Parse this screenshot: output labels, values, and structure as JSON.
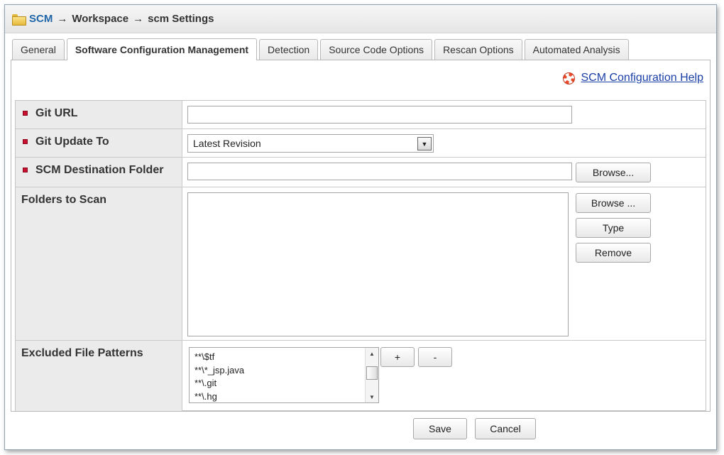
{
  "breadcrumb": {
    "root": "SCM",
    "separator": "→",
    "workspace": "Workspace",
    "current": "scm Settings"
  },
  "tabs": [
    {
      "label": "General",
      "active": false
    },
    {
      "label": "Software Configuration Management",
      "active": true
    },
    {
      "label": "Detection",
      "active": false
    },
    {
      "label": "Source Code Options",
      "active": false
    },
    {
      "label": "Rescan Options",
      "active": false
    },
    {
      "label": "Automated Analysis",
      "active": false
    }
  ],
  "help": {
    "icon": "lifebuoy-icon",
    "label": "SCM Configuration Help"
  },
  "form": {
    "git_url": {
      "label": "Git URL",
      "value": ""
    },
    "git_update_to": {
      "label": "Git Update To",
      "selected": "Latest Revision"
    },
    "scm_destination": {
      "label": "SCM Destination Folder",
      "value": "",
      "browse_label": "Browse..."
    },
    "folders_to_scan": {
      "label": "Folders to Scan",
      "browse_label": "Browse ...",
      "type_label": "Type",
      "remove_label": "Remove"
    },
    "excluded_patterns": {
      "label": "Excluded File Patterns",
      "items": [
        "**\\$tf",
        "**\\*_jsp.java",
        "**\\.git",
        "**\\.hg"
      ],
      "add_label": "+",
      "remove_label": "-"
    }
  },
  "footer": {
    "save_label": "Save",
    "cancel_label": "Cancel"
  },
  "colors": {
    "required_marker": "#c8102e",
    "link": "#1b3fa8",
    "label_bg": "#ebebeb"
  }
}
